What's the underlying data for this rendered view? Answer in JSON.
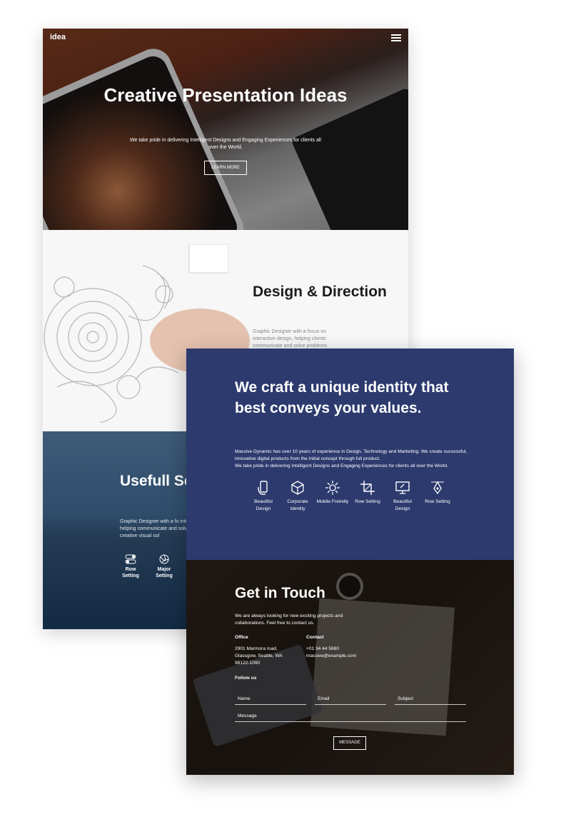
{
  "hero": {
    "logo": "idea",
    "title": "Creative Presentation Ideas",
    "subtitle": "We take pride in delivering Intelligent Designs and Engaging Experiences for clients all over the World.",
    "button": "LEARN MORE"
  },
  "design_section": {
    "title": "Design & Direction",
    "text": "Graphic Designer with a focus on interactive design, helping clients communicate and solve problems"
  },
  "ocean_section": {
    "title": "Usefull Semplic",
    "text": "Graphic Designer with a fo interactive design, helping communicate and solve p through creative visual sol",
    "features": [
      {
        "label": "Row Setting",
        "icon": "toggle-icon"
      },
      {
        "label": "Major Setting",
        "icon": "aperture-icon"
      }
    ]
  },
  "identity_section": {
    "title": "We craft a unique identity that best conveys your values.",
    "paragraph1": "Massive Dynamic has over 10 years of experience in Design, Technology and Marketing. We create successful, innovative digital products from the initial concept through full product.",
    "paragraph2": "We take pride in delivering Intelligent Designs and Engaging Experiences for clients all over the World.",
    "services": [
      {
        "label": "Beautiful Design",
        "icon": "phone-hand-icon"
      },
      {
        "label": "Corporate Identity",
        "icon": "cube-icon"
      },
      {
        "label": "Mobile Freindly",
        "icon": "sun-icon"
      },
      {
        "label": "Row Setting",
        "icon": "crop-icon"
      },
      {
        "label": "Beautiful Design",
        "icon": "monitor-icon"
      },
      {
        "label": "Row Setting",
        "icon": "pen-tool-icon"
      }
    ]
  },
  "contact_section": {
    "title": "Get in Touch",
    "intro": "We are always looking for new exciting projects and collaborations. Feel free to contact us.",
    "office_label": "Office",
    "office_address": [
      "2901 Marmora road,",
      "Glassgow, Seattle, WA",
      "98122-1090"
    ],
    "contact_label": "Contact",
    "contact_phone": "+01 34 44 5880",
    "contact_email": "massive@example.com",
    "follow_label": "Follow us",
    "form": {
      "name": "Name",
      "email": "Email",
      "subject": "Subject",
      "message": "Message",
      "submit": "MESSAGE"
    }
  }
}
